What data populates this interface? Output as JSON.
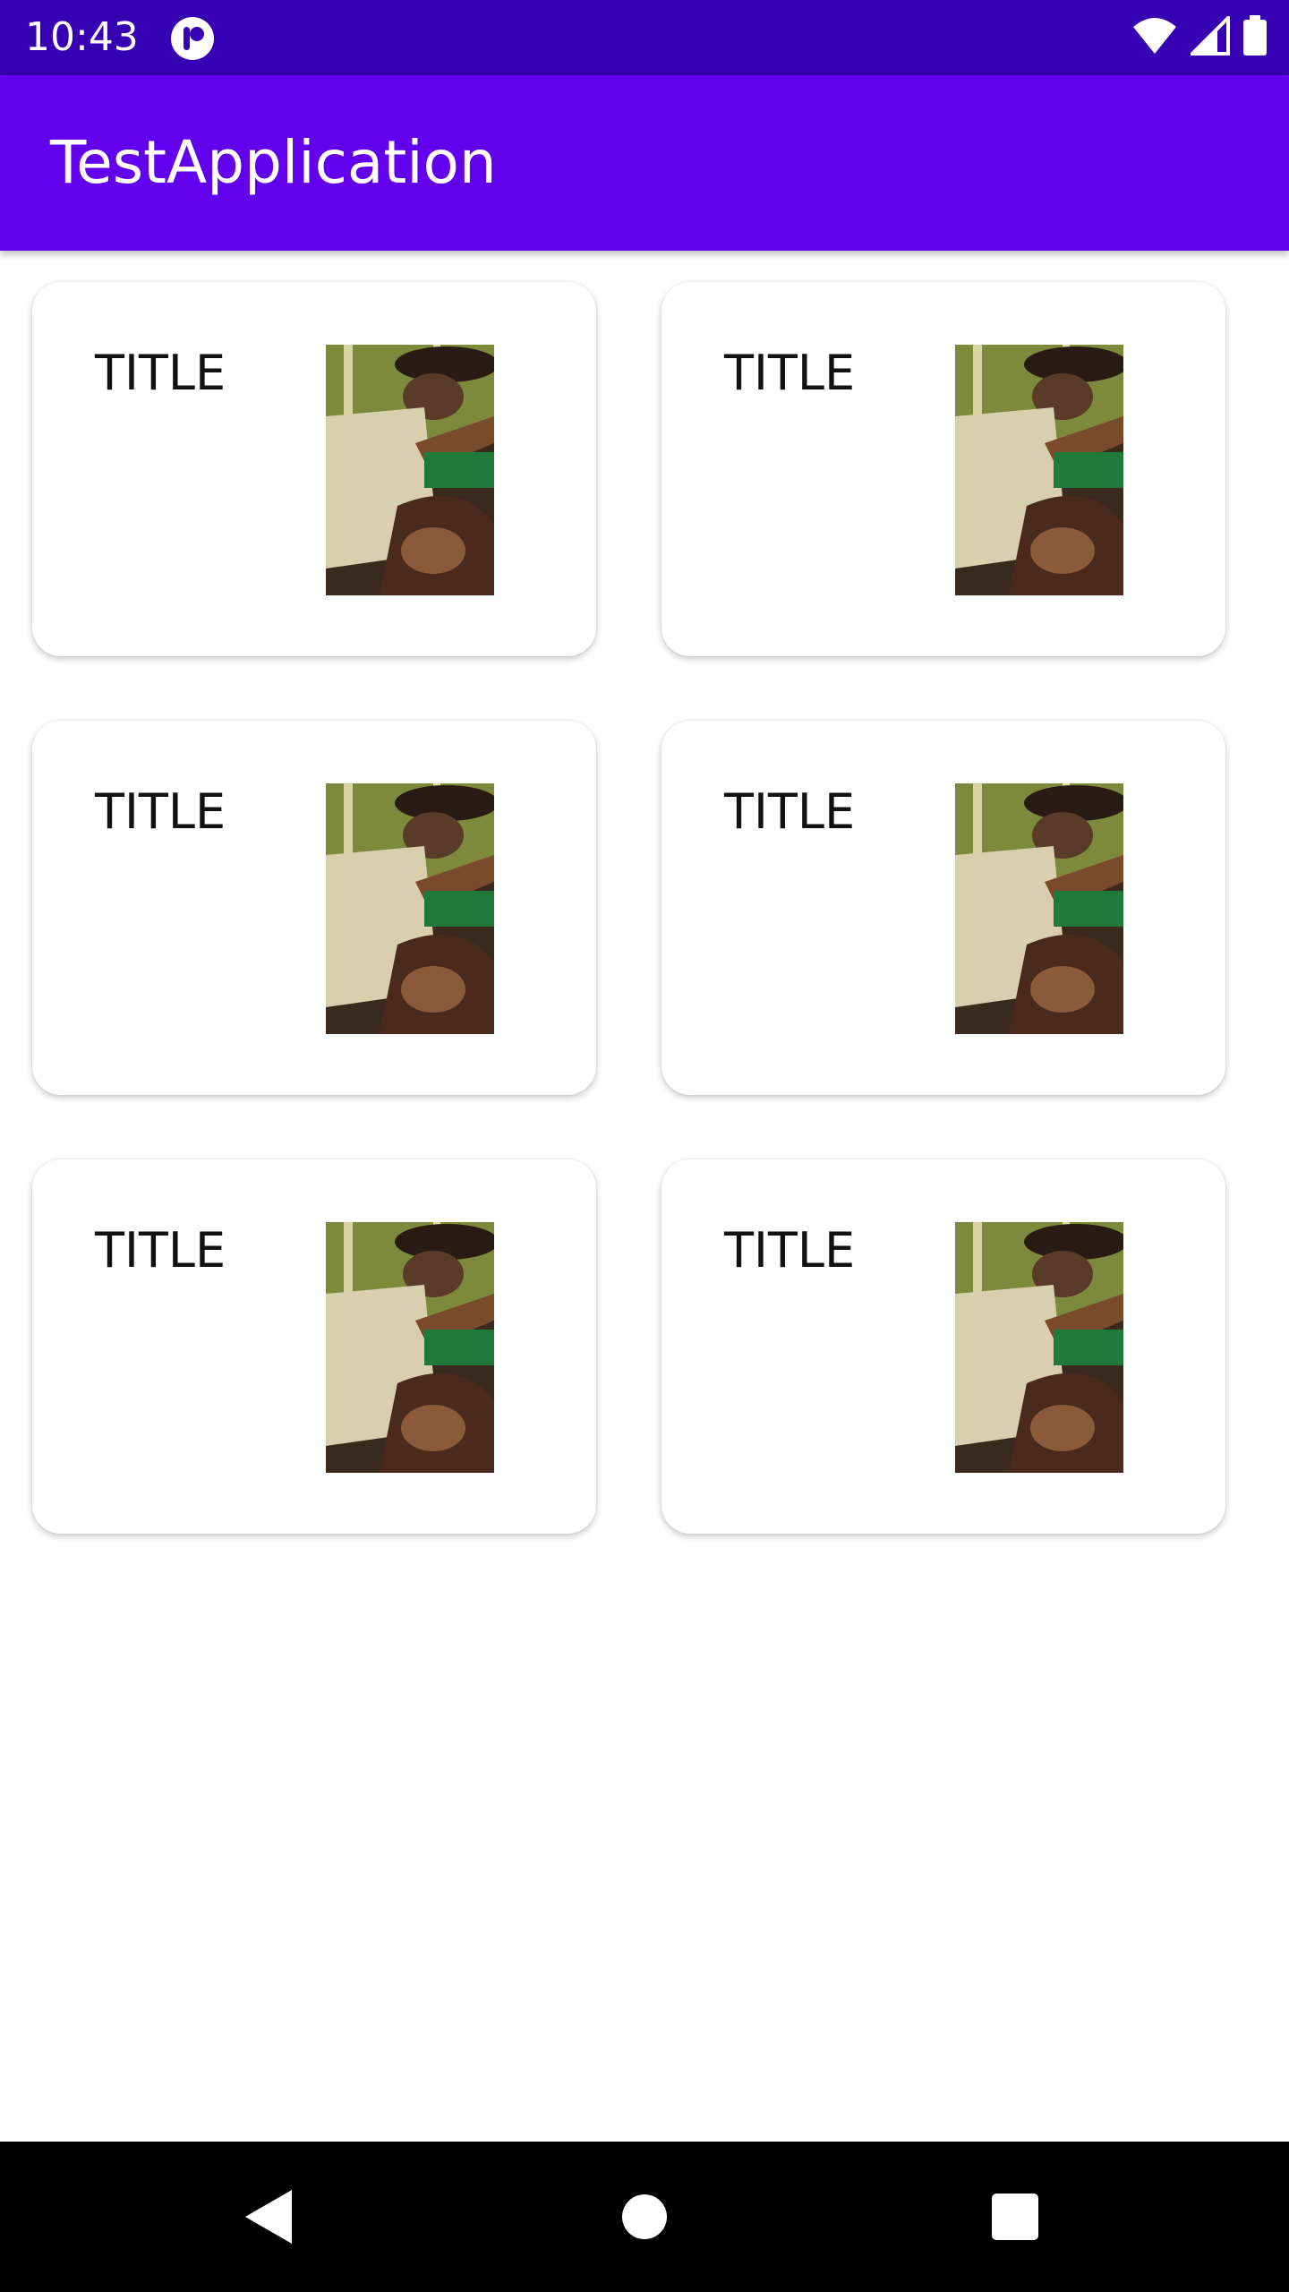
{
  "status_bar": {
    "time": "10:43",
    "icons": [
      "app-notification-icon",
      "wifi-icon",
      "signal-icon",
      "battery-icon"
    ],
    "background": "#3700b3"
  },
  "app_bar": {
    "title": "TestApplication",
    "background": "#6200ee"
  },
  "cards": [
    {
      "title": "TITLE",
      "image": "photo-person-in-hat"
    },
    {
      "title": "TITLE",
      "image": "photo-person-in-hat"
    },
    {
      "title": "TITLE",
      "image": "photo-person-in-hat"
    },
    {
      "title": "TITLE",
      "image": "photo-person-in-hat"
    },
    {
      "title": "TITLE",
      "image": "photo-person-in-hat"
    },
    {
      "title": "TITLE",
      "image": "photo-person-in-hat"
    }
  ],
  "nav_bar": {
    "buttons": [
      "back-icon",
      "home-icon",
      "recents-icon"
    ],
    "background": "#000000"
  }
}
